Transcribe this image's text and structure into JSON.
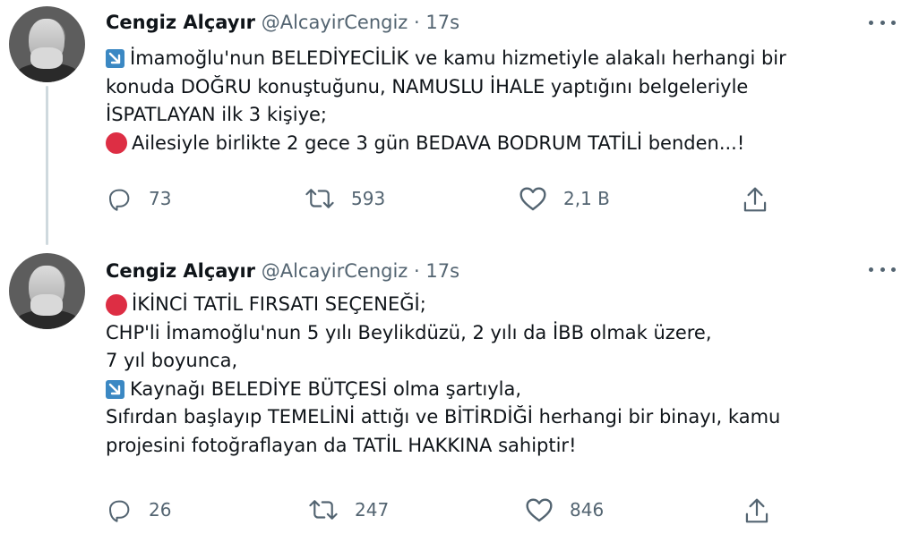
{
  "tweets": [
    {
      "name": "Cengiz Alçayır",
      "handle": "@AlcayirCengiz",
      "separator": "·",
      "time": "17s",
      "lines": [
        {
          "emoji": "arrow-down-right-emoji",
          "text": "İmamoğlu'nun BELEDİYECİLİK ve kamu hizmetiyle alakalı herhangi bir"
        },
        {
          "emoji": null,
          "text": "konuda DOĞRU konuştuğunu, NAMUSLU İHALE yaptığını belgeleriyle"
        },
        {
          "emoji": null,
          "text": "İSPATLAYAN ilk 3 kişiye;"
        },
        {
          "emoji": "red-circle-emoji",
          "text": "Ailesiyle birlikte 2 gece 3 gün BEDAVA BODRUM TATİLİ  benden...!"
        }
      ],
      "replies": "73",
      "retweets": "593",
      "likes": "2,1 B"
    },
    {
      "name": "Cengiz Alçayır",
      "handle": "@AlcayirCengiz",
      "separator": "·",
      "time": "17s",
      "lines": [
        {
          "emoji": "red-circle-emoji",
          "text": "İKİNCİ TATİL FIRSATI SEÇENEĞİ;"
        },
        {
          "emoji": null,
          "text": "CHP'li İmamoğlu'nun 5 yılı Beylikdüzü, 2 yılı da İBB olmak üzere,"
        },
        {
          "emoji": null,
          "text": "7 yıl boyunca,"
        },
        {
          "emoji": "arrow-down-right-emoji",
          "text": "Kaynağı BELEDİYE BÜTÇESİ olma şartıyla,"
        },
        {
          "emoji": null,
          "text": "Sıfırdan başlayıp TEMELİNİ attığı ve BİTİRDİĞİ herhangi bir binayı, kamu"
        },
        {
          "emoji": null,
          "text": "projesini fotoğraflayan da TATİL HAKKINA sahiptir!"
        }
      ],
      "replies": "26",
      "retweets": "247",
      "likes": "846"
    }
  ],
  "colors": {
    "text": "#0f1419",
    "muted": "#536471",
    "thread_line": "#cfd9de",
    "emoji_arrow": "#3b88c3",
    "emoji_circle": "#dd2e44"
  }
}
